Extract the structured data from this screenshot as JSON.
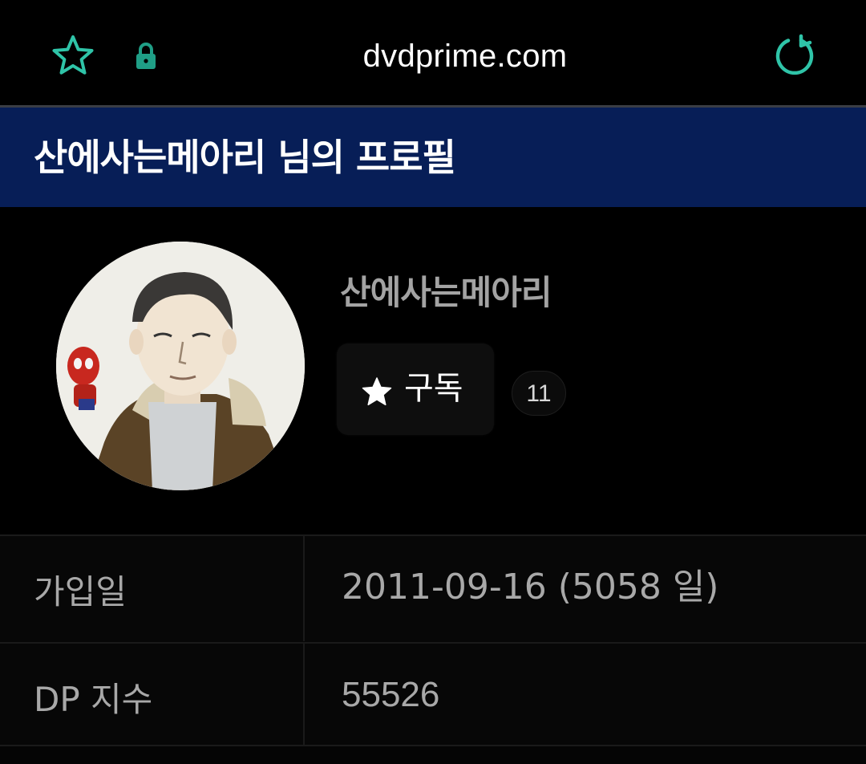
{
  "browser": {
    "url": "dvdprime.com",
    "icons": {
      "bookmark": "star-outline-icon",
      "secure": "lock-icon",
      "reload": "reload-icon"
    },
    "accent_color": "#2fc4a8"
  },
  "banner": {
    "title": "산에사는메아리 님의 프로필",
    "background": "#071e57"
  },
  "profile": {
    "username": "산에사는메아리",
    "subscribe_label": "구독",
    "subscribe_icon": "star-icon",
    "subscriber_count": "11"
  },
  "info": {
    "rows": [
      {
        "key": "가입일",
        "value": "2011-09-16 (5058 일)"
      },
      {
        "key": "DP 지수",
        "value": "55526"
      }
    ]
  }
}
